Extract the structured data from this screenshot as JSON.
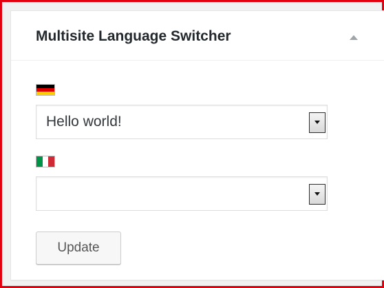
{
  "widget": {
    "title": "Multisite Language Switcher",
    "toggle_icon": "triangle-up-icon"
  },
  "languages": [
    {
      "flag_icon": "flag-de-icon",
      "flag_colors": [
        "#000000",
        "#dd0000",
        "#ffce00"
      ],
      "selected_value": "Hello world!"
    },
    {
      "flag_icon": "flag-it-icon",
      "flag_colors": [
        "#009246",
        "#ffffff",
        "#ce2b37"
      ],
      "selected_value": ""
    }
  ],
  "actions": {
    "update_label": "Update"
  },
  "colors": {
    "highlight_border": "#e3000f",
    "title_text": "#23282d",
    "toggle_arrow": "#a0a5aa"
  }
}
